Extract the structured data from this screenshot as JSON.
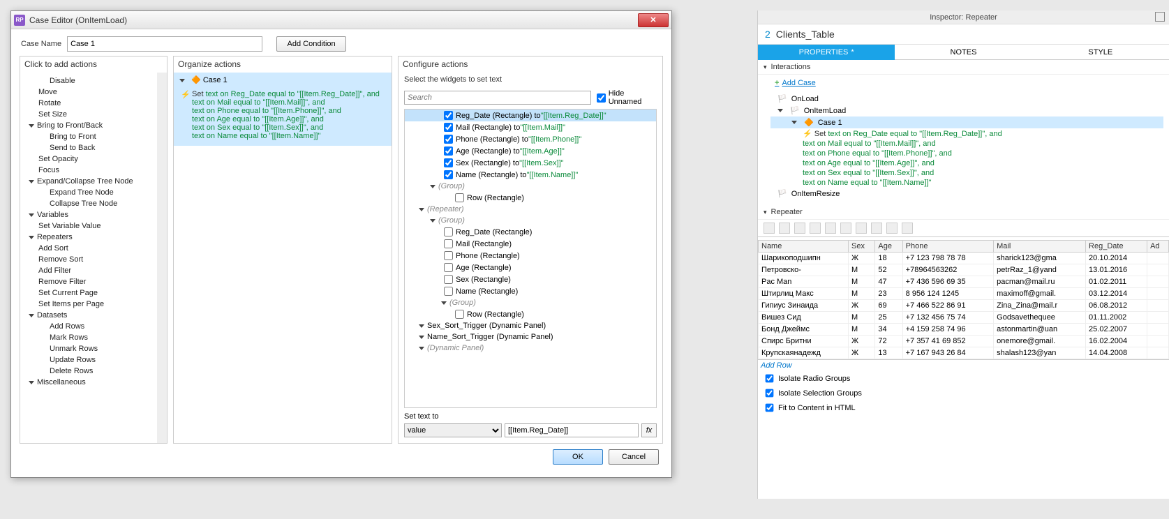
{
  "dialog": {
    "title": "Case Editor (OnItemLoad)",
    "case_name_label": "Case Name",
    "case_name_value": "Case 1",
    "add_condition": "Add Condition",
    "col1_title": "Click to add actions",
    "col2_title": "Organize actions",
    "col3_title": "Configure actions",
    "cfg_subtitle": "Select the widgets to set text",
    "search_placeholder": "Search",
    "hide_unnamed": "Hide Unnamed",
    "set_text_label": "Set text to",
    "set_text_type": "value",
    "set_text_value": "[[Item.Reg_Date]]",
    "fx": "fx",
    "ok": "OK",
    "cancel": "Cancel",
    "rp_badge": "RP",
    "close": "✕"
  },
  "actions_tree": {
    "items": [
      {
        "t": "item",
        "label": "Disable",
        "indent": 2
      },
      {
        "t": "item",
        "label": "Move",
        "indent": 1
      },
      {
        "t": "item",
        "label": "Rotate",
        "indent": 1
      },
      {
        "t": "item",
        "label": "Set Size",
        "indent": 1
      },
      {
        "t": "head",
        "label": "Bring to Front/Back"
      },
      {
        "t": "item",
        "label": "Bring to Front",
        "indent": 2
      },
      {
        "t": "item",
        "label": "Send to Back",
        "indent": 2
      },
      {
        "t": "item",
        "label": "Set Opacity",
        "indent": 1
      },
      {
        "t": "item",
        "label": "Focus",
        "indent": 1
      },
      {
        "t": "head",
        "label": "Expand/Collapse Tree Node"
      },
      {
        "t": "item",
        "label": "Expand Tree Node",
        "indent": 2
      },
      {
        "t": "item",
        "label": "Collapse Tree Node",
        "indent": 2
      },
      {
        "t": "head",
        "label": "Variables"
      },
      {
        "t": "item",
        "label": "Set Variable Value",
        "indent": 1
      },
      {
        "t": "head",
        "label": "Repeaters"
      },
      {
        "t": "item",
        "label": "Add Sort",
        "indent": 1
      },
      {
        "t": "item",
        "label": "Remove Sort",
        "indent": 1
      },
      {
        "t": "item",
        "label": "Add Filter",
        "indent": 1
      },
      {
        "t": "item",
        "label": "Remove Filter",
        "indent": 1
      },
      {
        "t": "item",
        "label": "Set Current Page",
        "indent": 1
      },
      {
        "t": "item",
        "label": "Set Items per Page",
        "indent": 1
      },
      {
        "t": "head",
        "label": "Datasets"
      },
      {
        "t": "item",
        "label": "Add Rows",
        "indent": 2
      },
      {
        "t": "item",
        "label": "Mark Rows",
        "indent": 2
      },
      {
        "t": "item",
        "label": "Unmark Rows",
        "indent": 2
      },
      {
        "t": "item",
        "label": "Update Rows",
        "indent": 2
      },
      {
        "t": "item",
        "label": "Delete Rows",
        "indent": 2
      },
      {
        "t": "head",
        "label": "Miscellaneous"
      }
    ]
  },
  "organize": {
    "case_label": "Case 1",
    "I": "Set ",
    "a": "text on Reg_Date equal to \"[[Item.Reg_Date]]\", and",
    "b": "text on Mail equal to \"[[Item.Mail]]\", and",
    "c": "text on Phone equal to \"[[Item.Phone]]\", and",
    "d": "text on Age equal to \"[[Item.Age]]\", and",
    "e": "text on Sex equal to \"[[Item.Sex]]\", and",
    "f": "text on Name equal to \"[[Item.Name]]\""
  },
  "widgets": [
    {
      "depth": 3,
      "chk": true,
      "sel": true,
      "pre": "Reg_Date (Rectangle) to ",
      "val": "\"[[Item.Reg_Date]]\""
    },
    {
      "depth": 3,
      "chk": true,
      "pre": "Mail (Rectangle) to ",
      "val": "\"[[Item.Mail]]\""
    },
    {
      "depth": 3,
      "chk": true,
      "pre": "Phone (Rectangle) to ",
      "val": "\"[[Item.Phone]]\""
    },
    {
      "depth": 3,
      "chk": true,
      "pre": "Age (Rectangle) to ",
      "val": "\"[[Item.Age]]\""
    },
    {
      "depth": 3,
      "chk": true,
      "pre": "Sex (Rectangle) to ",
      "val": "\"[[Item.Sex]]\""
    },
    {
      "depth": 3,
      "chk": true,
      "pre": "Name (Rectangle) to ",
      "val": "\"[[Item.Name]]\""
    },
    {
      "depth": 2,
      "tri": true,
      "grey": true,
      "pre": "(Group)"
    },
    {
      "depth": 4,
      "chk": false,
      "pre": "Row (Rectangle)"
    },
    {
      "depth": 1,
      "tri": true,
      "grey": true,
      "pre": "(Repeater)"
    },
    {
      "depth": 2,
      "tri": true,
      "grey": true,
      "pre": "(Group)"
    },
    {
      "depth": 3,
      "chk": false,
      "pre": "Reg_Date (Rectangle)"
    },
    {
      "depth": 3,
      "chk": false,
      "pre": "Mail (Rectangle)"
    },
    {
      "depth": 3,
      "chk": false,
      "pre": "Phone (Rectangle)"
    },
    {
      "depth": 3,
      "chk": false,
      "pre": "Age (Rectangle)"
    },
    {
      "depth": 3,
      "chk": false,
      "pre": "Sex (Rectangle)"
    },
    {
      "depth": 3,
      "chk": false,
      "pre": "Name (Rectangle)"
    },
    {
      "depth": 3,
      "tri": true,
      "grey": true,
      "pre": "(Group)"
    },
    {
      "depth": 4,
      "chk": false,
      "pre": "Row (Rectangle)"
    },
    {
      "depth": 1,
      "tri": true,
      "pre": "Sex_Sort_Trigger (Dynamic Panel)"
    },
    {
      "depth": 1,
      "tri": true,
      "pre": "Name_Sort_Trigger (Dynamic Panel)"
    },
    {
      "depth": 1,
      "tri": true,
      "grey": true,
      "pre": "(Dynamic Panel)"
    }
  ],
  "inspector": {
    "title": "Inspector: Repeater",
    "num": "2",
    "name": "Clients_Table",
    "tab_props": "PROPERTIES",
    "tab_notes": "NOTES",
    "tab_style": "STYLE",
    "sec_interactions": "Interactions",
    "add_case": "Add Case",
    "ev_onload": "OnLoad",
    "ev_onitemload": "OnItemLoad",
    "case1": "Case 1",
    "act_set": "Set ",
    "a": "text on Reg_Date equal to \"[[Item.Reg_Date]]\", and",
    "b": "text on Mail equal to \"[[Item.Mail]]\", and",
    "c": "text on Phone equal to \"[[Item.Phone]]\", and",
    "d": "text on Age equal to \"[[Item.Age]]\", and",
    "e": "text on Sex equal to \"[[Item.Sex]]\", and",
    "f": "text on Name equal to \"[[Item.Name]]\"",
    "ev_onitemresize": "OnItemResize",
    "sec_repeater": "Repeater",
    "add_row_link": "Add Row",
    "isolate_radio": "Isolate Radio Groups",
    "isolate_sel": "Isolate Selection Groups",
    "fit_html": "Fit to Content in HTML"
  },
  "table": {
    "cols": [
      "Name",
      "Sex",
      "Age",
      "Phone",
      "Mail",
      "Reg_Date",
      "Ad"
    ],
    "rows": [
      [
        "Шарикоподшипн",
        "Ж",
        "18",
        "+7 123 798 78 78",
        "sharick123@gma",
        "20.10.2014",
        ""
      ],
      [
        "Петровско-",
        "М",
        "52",
        "+78964563262",
        "petrRaz_1@yand",
        "13.01.2016",
        ""
      ],
      [
        "Pac Man",
        "М",
        "47",
        "+7 436 596 69 35",
        "pacman@mail.ru",
        "01.02.2011",
        ""
      ],
      [
        "Штирлиц Макс",
        "М",
        "23",
        "8 956 124 1245",
        "maximoff@gmail.",
        "03.12.2014",
        ""
      ],
      [
        "Гипиус Зинаида",
        "Ж",
        "69",
        "+7 466 522 86 91",
        "Zina_Zina@mail.r",
        "06.08.2012",
        ""
      ],
      [
        "Вишез Сид",
        "М",
        "25",
        "+7 132 456 75 74",
        "Godsavethequee",
        "01.11.2002",
        ""
      ],
      [
        "Бонд Джеймс",
        "М",
        "34",
        "+4 159 258 74 96",
        "astonmartin@uan",
        "25.02.2007",
        ""
      ],
      [
        "Спирс Бритни",
        "Ж",
        "72",
        "+7 357 41 69 852",
        "onemore@gmail.",
        "16.02.2004",
        ""
      ],
      [
        "Крупскаянадежд",
        "Ж",
        "13",
        "+7 167 943 26 84",
        "shalash123@yan",
        "14.04.2008",
        ""
      ]
    ]
  }
}
